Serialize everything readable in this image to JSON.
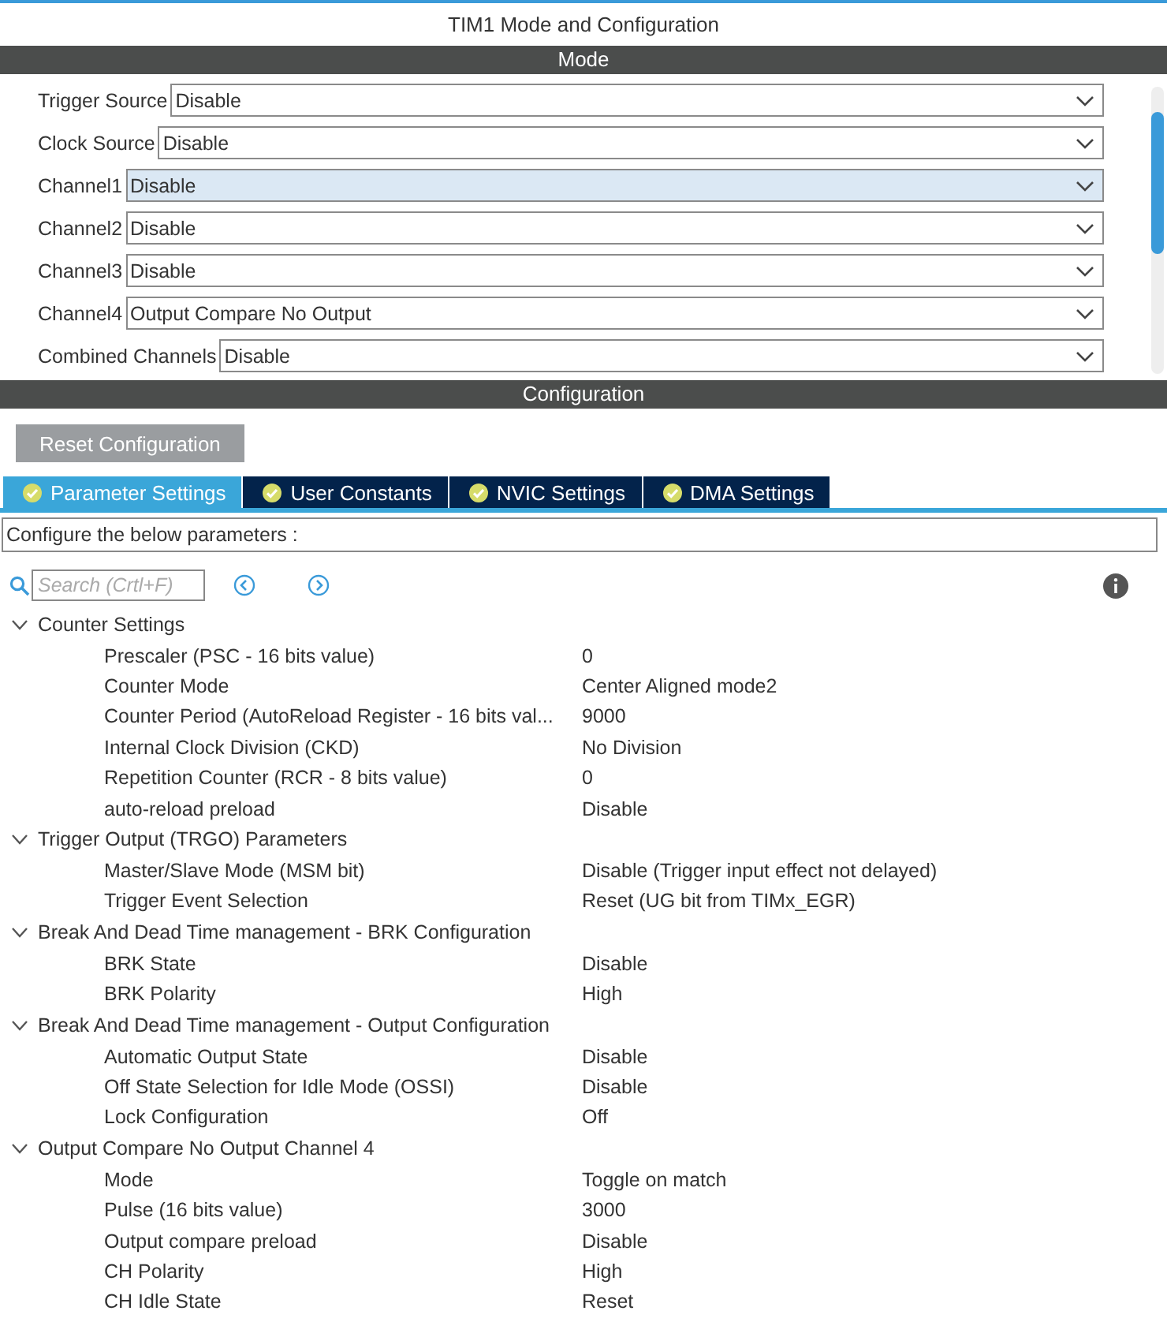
{
  "window": {
    "title": "TIM1 Mode and Configuration"
  },
  "mode": {
    "header": "Mode",
    "fields": [
      {
        "label": "Trigger Source",
        "value": "Disable",
        "focused": false
      },
      {
        "label": "Clock Source",
        "value": "Disable",
        "focused": false
      },
      {
        "label": "Channel1",
        "value": "Disable",
        "focused": true
      },
      {
        "label": "Channel2",
        "value": "Disable",
        "focused": false
      },
      {
        "label": "Channel3",
        "value": "Disable",
        "focused": false
      },
      {
        "label": "Channel4",
        "value": "Output Compare No Output",
        "focused": false
      },
      {
        "label": "Combined Channels",
        "value": "Disable",
        "focused": false
      }
    ]
  },
  "configuration": {
    "header": "Configuration",
    "reset_button": "Reset Configuration",
    "tabs": [
      {
        "label": "Parameter Settings",
        "selected": true
      },
      {
        "label": "User Constants",
        "selected": false
      },
      {
        "label": "NVIC Settings",
        "selected": false
      },
      {
        "label": "DMA Settings",
        "selected": false
      }
    ],
    "description": "Configure the below parameters :",
    "search": {
      "placeholder": "Search (Crtl+F)"
    },
    "groups": [
      {
        "label": "Counter Settings",
        "expanded": true,
        "children": [
          {
            "label": "Prescaler (PSC - 16 bits value)",
            "value": "0"
          },
          {
            "label": "Counter Mode",
            "value": "Center Aligned mode2"
          },
          {
            "label": "Counter Period (AutoReload Register - 16 bits val...",
            "value": "9000"
          },
          {
            "label": "Internal Clock Division (CKD)",
            "value": "No Division"
          },
          {
            "label": "Repetition Counter (RCR - 8 bits value)",
            "value": "0"
          },
          {
            "label": "auto-reload preload",
            "value": "Disable"
          }
        ]
      },
      {
        "label": "Trigger Output (TRGO) Parameters",
        "expanded": true,
        "children": [
          {
            "label": "Master/Slave Mode (MSM bit)",
            "value": "Disable (Trigger input effect not delayed)"
          },
          {
            "label": "Trigger Event Selection",
            "value": "Reset (UG bit from TIMx_EGR)"
          }
        ]
      },
      {
        "label": "Break And Dead Time management - BRK Configuration",
        "expanded": true,
        "children": [
          {
            "label": "BRK State",
            "value": "Disable"
          },
          {
            "label": "BRK Polarity",
            "value": "High"
          }
        ]
      },
      {
        "label": "Break And Dead Time management - Output Configuration",
        "expanded": true,
        "children": [
          {
            "label": "Automatic Output State",
            "value": "Disable"
          },
          {
            "label": "Off State Selection for Idle Mode (OSSI)",
            "value": "Disable"
          },
          {
            "label": "Lock Configuration",
            "value": "Off"
          }
        ]
      },
      {
        "label": "Output Compare No Output Channel 4",
        "expanded": true,
        "children": [
          {
            "label": "Mode",
            "value": "Toggle on match"
          },
          {
            "label": "Pulse (16 bits value)",
            "value": "3000"
          },
          {
            "label": "Output compare preload",
            "value": "Disable"
          },
          {
            "label": "CH Polarity",
            "value": "High"
          },
          {
            "label": "CH Idle State",
            "value": "Reset"
          }
        ]
      }
    ]
  }
}
